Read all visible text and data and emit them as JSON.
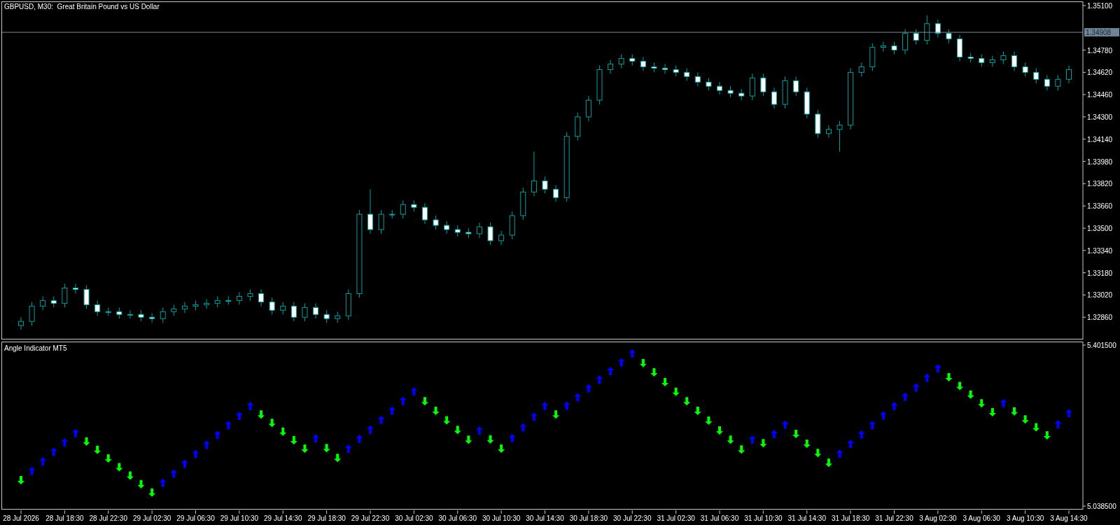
{
  "price_chart": {
    "chart_data": {
      "type": "candlestick",
      "title": "GBPUSD, M30:  Great Britain Pound vs US Dollar",
      "ylim": [
        1.327,
        1.3513
      ],
      "categories": [
        null,
        null,
        null,
        null,
        null,
        null,
        null,
        null,
        null,
        null,
        null,
        null,
        null,
        null,
        null,
        null,
        null,
        null,
        null,
        null,
        null,
        null,
        null,
        null,
        null,
        null,
        null,
        null,
        null,
        null,
        null,
        null,
        null,
        null,
        null,
        null,
        null,
        null,
        null,
        null,
        null,
        null,
        null,
        null,
        null,
        null,
        null,
        null,
        null,
        null,
        null,
        null,
        null,
        null,
        null,
        null,
        null,
        null,
        null,
        null,
        null,
        null,
        null,
        null,
        null,
        null,
        null,
        null,
        null,
        null,
        null,
        null,
        null,
        null,
        null,
        null,
        null,
        null,
        null,
        null,
        null,
        null,
        null,
        null,
        null,
        null,
        null,
        null,
        null,
        null,
        null,
        null,
        null,
        null,
        null,
        null,
        null
      ],
      "yticks": [
        {
          "value": 1.351,
          "label": "1.35100"
        },
        {
          "value": 1.3478,
          "label": "1.34780"
        },
        {
          "value": 1.3462,
          "label": "1.34620"
        },
        {
          "value": 1.3446,
          "label": "1.34460"
        },
        {
          "value": 1.343,
          "label": "1.34300"
        },
        {
          "value": 1.3414,
          "label": "1.34140"
        },
        {
          "value": 1.3398,
          "label": "1.33980"
        },
        {
          "value": 1.3382,
          "label": "1.33820"
        },
        {
          "value": 1.3366,
          "label": "1.33660"
        },
        {
          "value": 1.335,
          "label": "1.33500"
        },
        {
          "value": 1.3334,
          "label": "1.33340"
        },
        {
          "value": 1.3318,
          "label": "1.33180"
        },
        {
          "value": 1.3302,
          "label": "1.33020"
        },
        {
          "value": 1.3286,
          "label": "1.32860"
        }
      ],
      "ohlc": [
        [
          1.328,
          1.3286,
          1.3277,
          1.3283
        ],
        [
          1.3283,
          1.3297,
          1.328,
          1.3294
        ],
        [
          1.3294,
          1.3301,
          1.3291,
          1.3298
        ],
        [
          1.3298,
          1.3301,
          1.3293,
          1.3296
        ],
        [
          1.3296,
          1.331,
          1.3293,
          1.3307
        ],
        [
          1.3307,
          1.331,
          1.3303,
          1.3306
        ],
        [
          1.3306,
          1.3309,
          1.3292,
          1.3295
        ],
        [
          1.3295,
          1.3298,
          1.3287,
          1.329
        ],
        [
          1.329,
          1.3293,
          1.3287,
          1.329
        ],
        [
          1.329,
          1.3293,
          1.3285,
          1.3288
        ],
        [
          1.3288,
          1.3291,
          1.3285,
          1.3288
        ],
        [
          1.3288,
          1.3291,
          1.3283,
          1.3286
        ],
        [
          1.3286,
          1.3289,
          1.3282,
          1.3285
        ],
        [
          1.3285,
          1.3293,
          1.3282,
          1.329
        ],
        [
          1.329,
          1.3295,
          1.3287,
          1.3292
        ],
        [
          1.3292,
          1.3297,
          1.3289,
          1.3294
        ],
        [
          1.3294,
          1.3298,
          1.3291,
          1.3295
        ],
        [
          1.3295,
          1.3299,
          1.3292,
          1.3296
        ],
        [
          1.3296,
          1.3301,
          1.3293,
          1.3298
        ],
        [
          1.3298,
          1.3301,
          1.3295,
          1.3298
        ],
        [
          1.3298,
          1.3304,
          1.3295,
          1.3301
        ],
        [
          1.3301,
          1.3306,
          1.3298,
          1.3303
        ],
        [
          1.3303,
          1.3306,
          1.3294,
          1.3297
        ],
        [
          1.3297,
          1.33,
          1.3288,
          1.3291
        ],
        [
          1.3291,
          1.3297,
          1.3288,
          1.3294
        ],
        [
          1.3294,
          1.3297,
          1.3283,
          1.3286
        ],
        [
          1.3286,
          1.3296,
          1.3283,
          1.3293
        ],
        [
          1.3293,
          1.3296,
          1.3285,
          1.3288
        ],
        [
          1.3288,
          1.3291,
          1.3282,
          1.3285
        ],
        [
          1.3285,
          1.329,
          1.3282,
          1.3287
        ],
        [
          1.3287,
          1.3306,
          1.3284,
          1.3303
        ],
        [
          1.3303,
          1.3363,
          1.33,
          1.336
        ],
        [
          1.336,
          1.3378,
          1.3346,
          1.3349
        ],
        [
          1.3349,
          1.3363,
          1.3346,
          1.336
        ],
        [
          1.336,
          1.3363,
          1.3357,
          1.336
        ],
        [
          1.336,
          1.337,
          1.3357,
          1.3367
        ],
        [
          1.3367,
          1.337,
          1.3362,
          1.3365
        ],
        [
          1.3365,
          1.3368,
          1.3353,
          1.3356
        ],
        [
          1.3356,
          1.3359,
          1.3349,
          1.3352
        ],
        [
          1.3352,
          1.3355,
          1.3346,
          1.3349
        ],
        [
          1.3349,
          1.3352,
          1.3344,
          1.3347
        ],
        [
          1.3347,
          1.335,
          1.3343,
          1.3346
        ],
        [
          1.3346,
          1.3354,
          1.3343,
          1.3351
        ],
        [
          1.3351,
          1.3354,
          1.3338,
          1.3341
        ],
        [
          1.3341,
          1.3348,
          1.3338,
          1.3345
        ],
        [
          1.3345,
          1.3362,
          1.3342,
          1.3359
        ],
        [
          1.3359,
          1.3379,
          1.3356,
          1.3376
        ],
        [
          1.3376,
          1.3405,
          1.3373,
          1.3384
        ],
        [
          1.3384,
          1.3387,
          1.3375,
          1.3378
        ],
        [
          1.3378,
          1.3381,
          1.3369,
          1.3372
        ],
        [
          1.3372,
          1.3419,
          1.3369,
          1.3416
        ],
        [
          1.3416,
          1.3433,
          1.3413,
          1.343
        ],
        [
          1.343,
          1.3445,
          1.3427,
          1.3442
        ],
        [
          1.3442,
          1.3467,
          1.3439,
          1.3464
        ],
        [
          1.3464,
          1.3471,
          1.3461,
          1.3468
        ],
        [
          1.3468,
          1.3475,
          1.3465,
          1.3472
        ],
        [
          1.3472,
          1.3475,
          1.3467,
          1.347
        ],
        [
          1.347,
          1.3473,
          1.3463,
          1.3466
        ],
        [
          1.3466,
          1.3469,
          1.3462,
          1.3465
        ],
        [
          1.3465,
          1.3468,
          1.3461,
          1.3464
        ],
        [
          1.3464,
          1.3467,
          1.3459,
          1.3462
        ],
        [
          1.3462,
          1.3465,
          1.3456,
          1.3459
        ],
        [
          1.3459,
          1.3462,
          1.3452,
          1.3455
        ],
        [
          1.3455,
          1.3458,
          1.3449,
          1.3452
        ],
        [
          1.3452,
          1.3455,
          1.3446,
          1.3449
        ],
        [
          1.3449,
          1.3452,
          1.3444,
          1.3447
        ],
        [
          1.3447,
          1.345,
          1.3442,
          1.3445
        ],
        [
          1.3445,
          1.3461,
          1.3442,
          1.3458
        ],
        [
          1.3458,
          1.3461,
          1.3445,
          1.3448
        ],
        [
          1.3448,
          1.3451,
          1.3436,
          1.3439
        ],
        [
          1.3439,
          1.3459,
          1.3436,
          1.3456
        ],
        [
          1.3456,
          1.3459,
          1.3445,
          1.3448
        ],
        [
          1.3448,
          1.3451,
          1.3429,
          1.3432
        ],
        [
          1.3432,
          1.3435,
          1.3415,
          1.3418
        ],
        [
          1.3418,
          1.3424,
          1.3415,
          1.3421
        ],
        [
          1.3421,
          1.3427,
          1.3405,
          1.3424
        ],
        [
          1.3424,
          1.3465,
          1.3421,
          1.3462
        ],
        [
          1.3462,
          1.3469,
          1.3459,
          1.3466
        ],
        [
          1.3466,
          1.3483,
          1.3463,
          1.348
        ],
        [
          1.348,
          1.3484,
          1.3477,
          1.3481
        ],
        [
          1.3481,
          1.3484,
          1.3475,
          1.3478
        ],
        [
          1.3478,
          1.3493,
          1.3475,
          1.349
        ],
        [
          1.349,
          1.3493,
          1.3482,
          1.3485
        ],
        [
          1.3485,
          1.3503,
          1.3482,
          1.3497
        ],
        [
          1.3497,
          1.35,
          1.3487,
          1.349
        ],
        [
          1.349,
          1.3493,
          1.3483,
          1.3486
        ],
        [
          1.3486,
          1.3489,
          1.347,
          1.3473
        ],
        [
          1.3473,
          1.3476,
          1.3469,
          1.3472
        ],
        [
          1.3472,
          1.3475,
          1.3466,
          1.3469
        ],
        [
          1.3469,
          1.3474,
          1.3466,
          1.3471
        ],
        [
          1.3471,
          1.3477,
          1.3468,
          1.3474
        ],
        [
          1.3474,
          1.3477,
          1.3463,
          1.3466
        ],
        [
          1.3466,
          1.3469,
          1.3459,
          1.3462
        ],
        [
          1.3462,
          1.3465,
          1.3454,
          1.3457
        ],
        [
          1.3457,
          1.346,
          1.3449,
          1.3452
        ],
        [
          1.3452,
          1.346,
          1.3449,
          1.3457
        ],
        [
          1.3457,
          1.3467,
          1.3454,
          1.3464
        ]
      ],
      "ref_lines": [
        {
          "axis": "y",
          "value": 1.34908,
          "label": "1.34908"
        }
      ]
    }
  },
  "indicator": {
    "chart_data": {
      "type": "scatter",
      "title": "Angle Indicator MT5",
      "ylim": [
        5.0314,
        5.4086
      ],
      "categories": [
        "28 Jul 2026",
        null,
        null,
        null,
        "28 Jul 18:30",
        null,
        null,
        null,
        "28 Jul 22:30",
        null,
        null,
        null,
        "29 Jul 02:30",
        null,
        null,
        null,
        "29 Jul 06:30",
        null,
        null,
        null,
        "29 Jul 10:30",
        null,
        null,
        null,
        "29 Jul 14:30",
        null,
        null,
        null,
        "29 Jul 18:30",
        null,
        null,
        null,
        "29 Jul 22:30",
        null,
        null,
        null,
        "30 Jul 02:30",
        null,
        null,
        null,
        "30 Jul 06:30",
        null,
        null,
        null,
        "30 Jul 10:30",
        null,
        null,
        null,
        "30 Jul 14:30",
        null,
        null,
        null,
        "30 Jul 18:30",
        null,
        null,
        null,
        "30 Jul 22:30",
        null,
        null,
        null,
        "31 Jul 02:30",
        null,
        null,
        null,
        "31 Jul 06:30",
        null,
        null,
        null,
        "31 Jul 10:30",
        null,
        null,
        null,
        "31 Jul 14:30",
        null,
        null,
        null,
        "31 Jul 18:30",
        null,
        null,
        null,
        "31 Jul 22:30",
        null,
        null,
        null,
        "3 Aug 02:30",
        null,
        null,
        null,
        "3 Aug 06:30",
        null,
        null,
        null,
        "3 Aug 10:30",
        null,
        null,
        null,
        "3 Aug 14:30"
      ],
      "yticks": [
        {
          "value": 5.4015,
          "label": "5.401500"
        },
        {
          "value": 5.0385,
          "label": "5.038500"
        }
      ],
      "series": [
        {
          "color": "#0000ff",
          "values": [
            null,
            5.118,
            5.139,
            5.161,
            5.182,
            5.203,
            null,
            null,
            null,
            null,
            null,
            null,
            null,
            5.091,
            5.112,
            5.134,
            5.156,
            5.177,
            5.199,
            5.221,
            5.242,
            5.264,
            null,
            null,
            null,
            null,
            null,
            5.191,
            null,
            null,
            5.168,
            5.19,
            5.211,
            5.233,
            5.254,
            5.276,
            5.297,
            null,
            null,
            null,
            null,
            null,
            5.209,
            null,
            null,
            5.192,
            5.216,
            5.24,
            5.264,
            null,
            5.265,
            5.284,
            5.304,
            5.324,
            5.343,
            5.363,
            5.383,
            null,
            null,
            null,
            null,
            null,
            null,
            null,
            null,
            null,
            null,
            5.188,
            null,
            5.201,
            5.222,
            null,
            null,
            null,
            null,
            5.157,
            5.179,
            5.2,
            5.221,
            5.243,
            5.264,
            5.285,
            5.306,
            5.328,
            5.349,
            null,
            null,
            null,
            null,
            null,
            5.271,
            null,
            null,
            null,
            null,
            5.223,
            5.248
          ]
        },
        {
          "color": "#00ff00",
          "values": [
            5.097,
            null,
            null,
            null,
            null,
            null,
            5.184,
            5.165,
            5.146,
            5.126,
            5.107,
            5.088,
            5.069,
            null,
            null,
            null,
            null,
            null,
            null,
            null,
            null,
            null,
            5.245,
            5.226,
            5.206,
            5.187,
            5.168,
            null,
            5.169,
            5.147,
            null,
            null,
            null,
            null,
            null,
            null,
            null,
            5.275,
            5.253,
            5.232,
            5.21,
            5.188,
            null,
            5.189,
            5.168,
            null,
            null,
            null,
            null,
            5.245,
            null,
            null,
            null,
            null,
            null,
            null,
            null,
            5.361,
            5.34,
            5.318,
            5.296,
            5.275,
            5.253,
            5.231,
            5.209,
            5.188,
            5.166,
            null,
            5.18,
            null,
            null,
            5.201,
            5.179,
            5.158,
            5.136,
            null,
            null,
            null,
            null,
            null,
            null,
            null,
            null,
            null,
            null,
            5.329,
            5.309,
            5.29,
            5.27,
            5.25,
            null,
            5.252,
            5.234,
            5.216,
            5.198,
            null,
            null
          ]
        }
      ]
    }
  }
}
